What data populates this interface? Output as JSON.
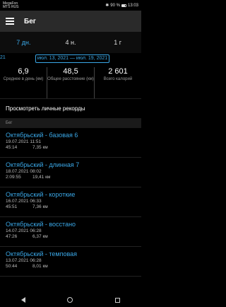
{
  "status": {
    "carrier_line1": "MegaFon",
    "carrier_line2": "MTS RUS",
    "battery": "90 %",
    "time": "13:03"
  },
  "app_bar": {
    "title": "Бег"
  },
  "range_tabs": [
    {
      "label": "7 дн.",
      "active": true
    },
    {
      "label": "4 н.",
      "active": false
    },
    {
      "label": "1 г",
      "active": false
    }
  ],
  "date": {
    "prev_fragment": "21",
    "range": "июл. 13, 2021 — июл. 19, 2021"
  },
  "stats": [
    {
      "value": "6,9",
      "label": "Среднее в день (км)"
    },
    {
      "value": "48,5",
      "label": "Общее расстояние (км)"
    },
    {
      "value": "2 601",
      "label": "Всего калорий"
    }
  ],
  "records_link": "Просмотреть личные рекорды",
  "section_header": "Бег",
  "activities": [
    {
      "title": "Октябрьский - базовая 6",
      "date": "19.07.2021 11:51",
      "duration": "45:14",
      "distance": "7,35 км"
    },
    {
      "title": "Октябрьский - длинная 7",
      "date": "18.07.2021 08:02",
      "duration": "2:09:55",
      "distance": "19,41 км"
    },
    {
      "title": "Октябрьский - короткие",
      "date": "16.07.2021 06:33",
      "duration": "45:51",
      "distance": "7,36 км"
    },
    {
      "title": "Октябрьский - восстано",
      "date": "14.07.2021 06:28",
      "duration": "47:26",
      "distance": "6,37 км"
    },
    {
      "title": "Октябрьский - темповая",
      "date": "13.07.2021 06:28",
      "duration": "50:44",
      "distance": "8,01 км"
    }
  ]
}
